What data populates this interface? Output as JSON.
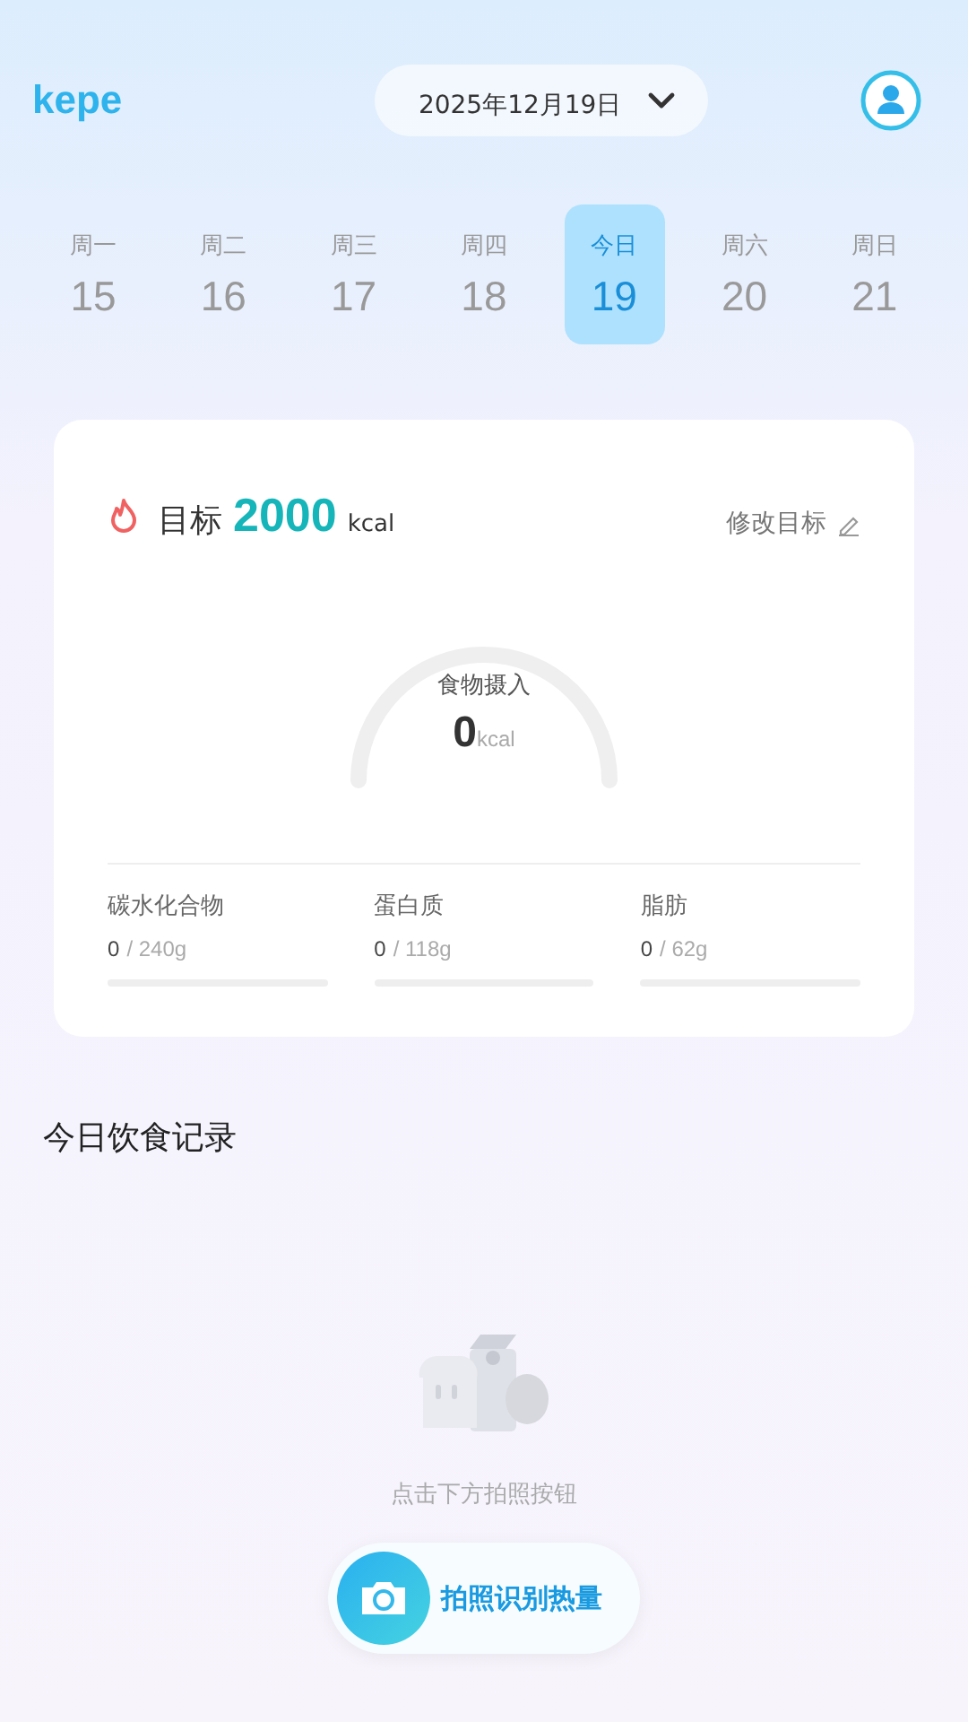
{
  "header": {
    "logo": "kepe",
    "date": "2025年12月19日"
  },
  "week": [
    {
      "day": "周一",
      "date": "15",
      "selected": false
    },
    {
      "day": "周二",
      "date": "16",
      "selected": false
    },
    {
      "day": "周三",
      "date": "17",
      "selected": false
    },
    {
      "day": "周四",
      "date": "18",
      "selected": false
    },
    {
      "day": "今日",
      "date": "19",
      "selected": true
    },
    {
      "day": "周六",
      "date": "20",
      "selected": false
    },
    {
      "day": "周日",
      "date": "21",
      "selected": false
    }
  ],
  "goal": {
    "label": "目标",
    "value": "2000",
    "unit": "kcal",
    "edit": "修改目标"
  },
  "gauge": {
    "label": "食物摄入",
    "value": "0",
    "unit": "kcal"
  },
  "macros": [
    {
      "name": "碳水化合物",
      "value": "0",
      "target": "/ 240g"
    },
    {
      "name": "蛋白质",
      "value": "0",
      "target": "/ 118g"
    },
    {
      "name": "脂肪",
      "value": "0",
      "target": "/ 62g"
    }
  ],
  "records": {
    "title": "今日饮食记录",
    "empty_hint": "点击下方拍照按钮"
  },
  "camera_button": "拍照识别热量"
}
